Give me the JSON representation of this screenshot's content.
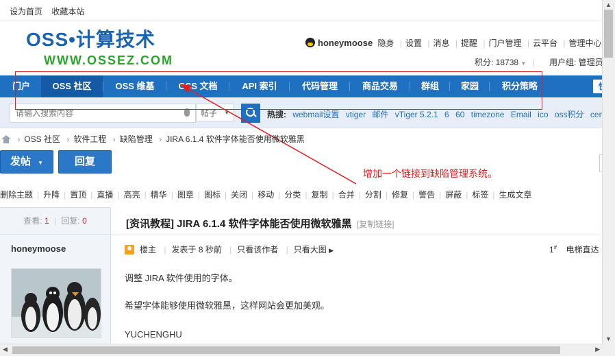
{
  "topbar": {
    "set_home": "设为首页",
    "bookmark": "收藏本站"
  },
  "logo": {
    "line1": "OSS•计算技术",
    "line2": "WWW.OSSEZ.COM"
  },
  "user": {
    "name": "honeymoose",
    "status": "隐身",
    "links": [
      "设置",
      "消息",
      "提醒",
      "门户管理",
      "云平台",
      "管理中心",
      "退"
    ],
    "points": "积分: 18738",
    "group": "用户组: 管理员"
  },
  "nav": {
    "items": [
      "门户",
      "OSS 社区",
      "OSS 维基",
      "OSS 文档",
      "API 索引",
      "代码管理",
      "商品交易",
      "群组",
      "家园",
      "积分策略"
    ],
    "active_index": 1,
    "quick": "快"
  },
  "search": {
    "placeholder": "请输入搜索内容",
    "scope": "帖子",
    "hot_label": "热搜:",
    "hot_terms": [
      "webmail设置",
      "vtiger",
      "邮件",
      "vTiger 5.2.1",
      "6",
      "60",
      "timezone",
      "Email",
      "ico",
      "oss积分",
      "cent"
    ]
  },
  "breadcrumb": [
    "OSS 社区",
    "软件工程",
    "缺陷管理",
    "JIRA 6.1.4 软件字体能否使用微软雅黑"
  ],
  "buttons": {
    "post": "发帖",
    "reply": "回复"
  },
  "annotation": "增加一个链接到缺陷管理系统。",
  "toolbar": [
    "删除主题",
    "升降",
    "置顶",
    "直播",
    "高亮",
    "精华",
    "图章",
    "图标",
    "关闭",
    "移动",
    "分类",
    "复制",
    "合并",
    "分割",
    "修复",
    "警告",
    "屏蔽",
    "标签",
    "生成文章"
  ],
  "thread": {
    "views_label": "查看:",
    "views": "1",
    "replies_label": "回复:",
    "replies": "0",
    "title": "[资讯教程] JIRA 6.1.4 软件字体能否使用微软雅黑",
    "copy_link": "[复制链接]",
    "author": "honeymoose",
    "meta": {
      "floor_owner": "楼主",
      "posted": "发表于 8 秒前",
      "only_author": "只看该作者",
      "big_image": "只看大图"
    },
    "floor_no": "1",
    "floor_suffix": "#",
    "elevator": "电梯直达",
    "body": [
      "调整 JIRA 软件使用的字体。",
      "希望字体能够使用微软雅黑，这样网站会更加美观。",
      "YUCHENGHU"
    ]
  },
  "colors": {
    "nav_blue": "#2070c2",
    "annotation_red": "#e02020",
    "logo_blue": "#1a63b0",
    "logo_green": "#2aa52a"
  }
}
